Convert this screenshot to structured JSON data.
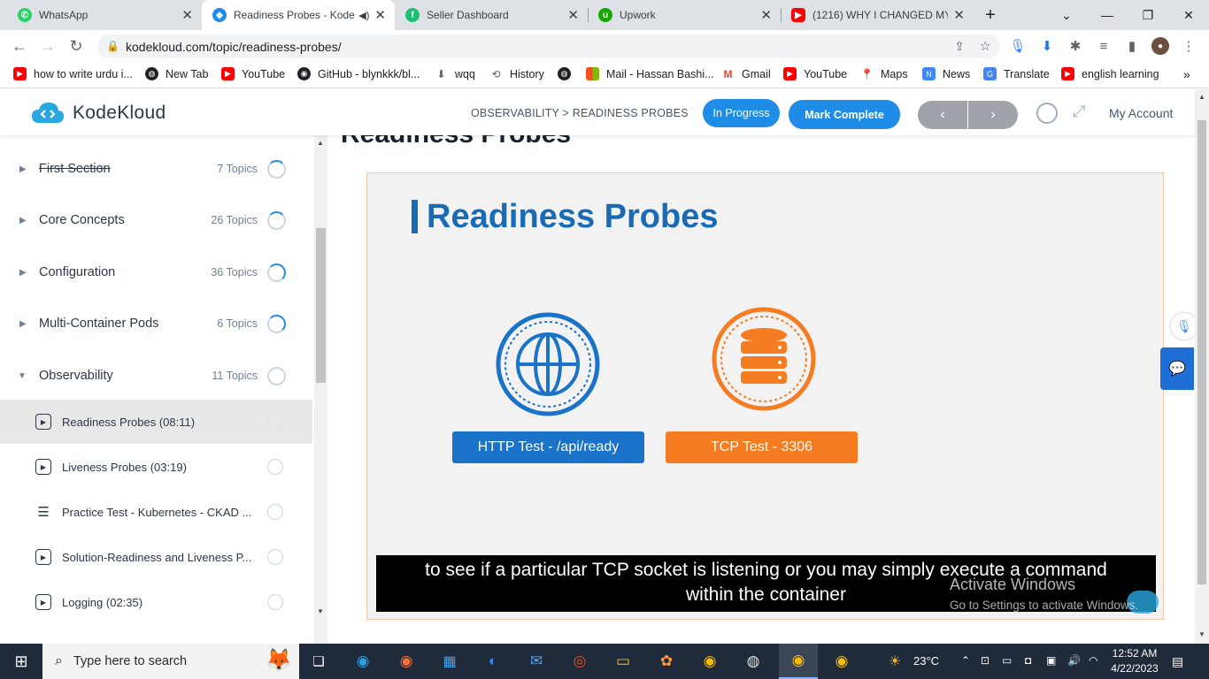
{
  "browser": {
    "tabs": [
      {
        "title": "WhatsApp",
        "icon": "whatsapp-icon",
        "color": "#25d366"
      },
      {
        "title": "Readiness Probes - Kode",
        "icon": "kodekloud-icon",
        "color": "#1f8ce8",
        "active": true
      },
      {
        "title": "Seller Dashboard",
        "icon": "fiverr-icon",
        "color": "#1dbf73"
      },
      {
        "title": "Upwork",
        "icon": "upwork-icon",
        "color": "#14a800"
      },
      {
        "title": "(1216) WHY I CHANGED MY",
        "icon": "youtube-icon",
        "color": "#ff0000"
      }
    ],
    "url": "kodekloud.com/topic/readiness-probes/",
    "bookmarks": [
      {
        "label": "how to write urdu i...",
        "icon": "youtube-icon",
        "color": "#ff0000"
      },
      {
        "label": "New Tab",
        "icon": "globe-icon",
        "color": "#202124"
      },
      {
        "label": "YouTube",
        "icon": "youtube-icon",
        "color": "#ff0000"
      },
      {
        "label": "GitHub - blynkkk/bl...",
        "icon": "github-icon",
        "color": "#202124"
      },
      {
        "label": "wqq",
        "icon": "download-icon",
        "color": "#5f6368"
      },
      {
        "label": "History",
        "icon": "history-icon",
        "color": "#5f6368"
      },
      {
        "label": "",
        "icon": "globe-icon",
        "color": "#202124"
      },
      {
        "label": "Mail - Hassan Bashi...",
        "icon": "microsoft-icon",
        "color": "#f25022"
      },
      {
        "label": "Gmail",
        "icon": "gmail-icon",
        "color": "#ea4335"
      },
      {
        "label": "YouTube",
        "icon": "youtube-icon",
        "color": "#ff0000"
      },
      {
        "label": "Maps",
        "icon": "maps-icon",
        "color": "#34a853"
      },
      {
        "label": "News",
        "icon": "news-icon",
        "color": "#4285f4"
      },
      {
        "label": "Translate",
        "icon": "translate-icon",
        "color": "#4285f4"
      },
      {
        "label": "english learning",
        "icon": "youtube-icon",
        "color": "#ff0000"
      }
    ]
  },
  "header": {
    "brand": "KodeKloud",
    "breadcrumb": "OBSERVABILITY > READINESS PROBES",
    "status_label": "In Progress",
    "mark_complete_label": "Mark Complete",
    "prev_label": "‹",
    "next_label": "›",
    "account_label": "My Account",
    "accent": "#1f8ce8"
  },
  "sidebar": {
    "sections": [
      {
        "name": "First Section",
        "count": "7 Topics",
        "strike": true
      },
      {
        "name": "Core Concepts",
        "count": "26 Topics"
      },
      {
        "name": "Configuration",
        "count": "36 Topics"
      },
      {
        "name": "Multi-Container Pods",
        "count": "6 Topics"
      },
      {
        "name": "Observability",
        "count": "11 Topics",
        "expanded": true
      }
    ],
    "lessons": [
      {
        "name": "Readiness Probes (08:11)",
        "icon": "video-icon",
        "selected": true
      },
      {
        "name": "Liveness Probes (03:19)",
        "icon": "video-icon"
      },
      {
        "name": "Practice Test - Kubernetes - CKAD ...",
        "icon": "list-icon"
      },
      {
        "name": "Solution-Readiness and Liveness P...",
        "icon": "video-icon"
      },
      {
        "name": "Logging (02:35)",
        "icon": "video-icon"
      }
    ]
  },
  "main": {
    "title": "Readiness Probes",
    "slide": {
      "title": "Readiness Probes",
      "http_label": "HTTP Test - /api/ready",
      "tcp_label": "TCP Test - 3306",
      "http_color": "#1a73c9",
      "tcp_color": "#f57c20"
    },
    "caption_line1": "to see if a particular TCP socket is listening or you may simply execute a command",
    "caption_line2": "within the container",
    "watermark_title": "Activate Windows",
    "watermark_sub": "Go to Settings to activate Windows."
  },
  "taskbar": {
    "search_placeholder": "Type here to search",
    "temperature": "23°C",
    "time": "12:52 AM",
    "date": "4/22/2023"
  }
}
